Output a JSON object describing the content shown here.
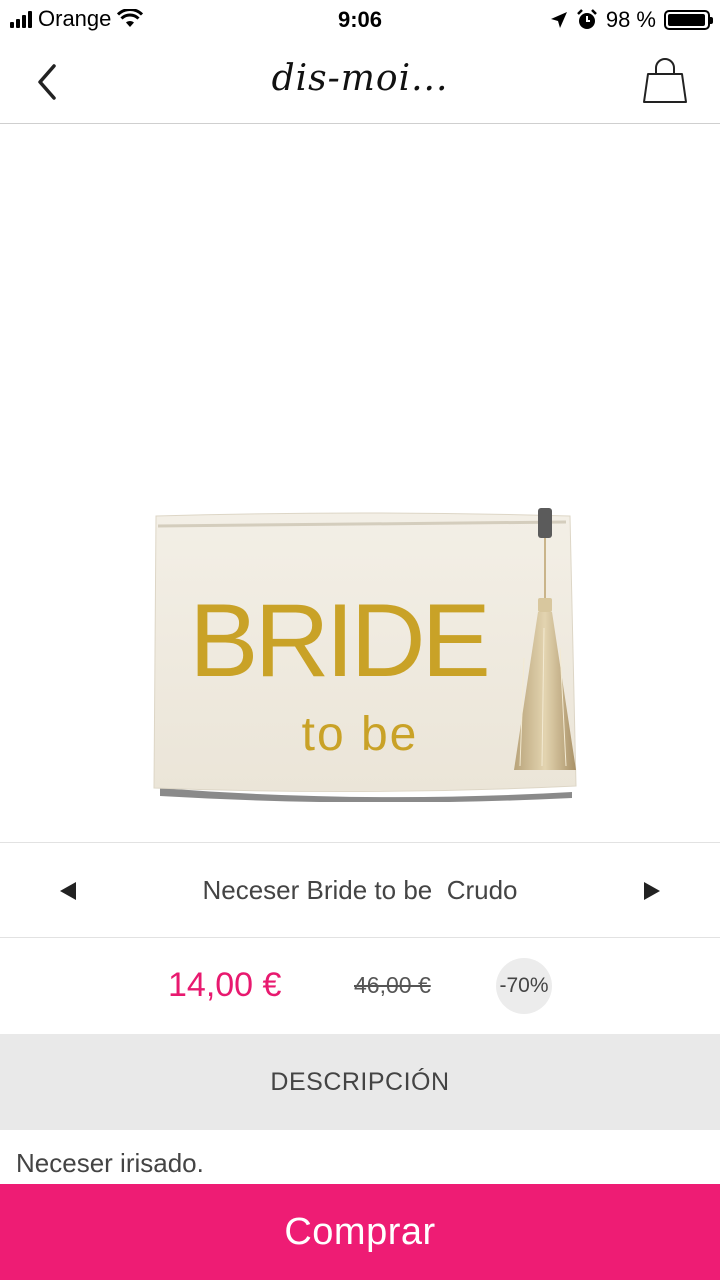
{
  "status_bar": {
    "carrier": "Orange",
    "time": "9:06",
    "battery_percent": "98 %",
    "battery_level": 0.98,
    "icons": [
      "signal-icon",
      "wifi-icon",
      "location-icon",
      "alarm-icon",
      "battery-icon"
    ]
  },
  "nav": {
    "logo_text": "dis-moi...",
    "back_icon": "chevron-left-icon",
    "cart_icon": "shopping-bag-icon"
  },
  "product_image": {
    "line1": "BRIDE",
    "line2": "to be"
  },
  "product": {
    "name": "Neceser Bride to be  Crudo",
    "price": "14,00 €",
    "old_price": "46,00 €",
    "discount": "-70%"
  },
  "description": {
    "header": "DESCRIPCIÓN",
    "text": "Neceser irisado."
  },
  "buy_button": {
    "label": "Comprar"
  },
  "colors": {
    "accent": "#ee1c74",
    "price": "#e8196f",
    "gold": "#c9a227"
  }
}
